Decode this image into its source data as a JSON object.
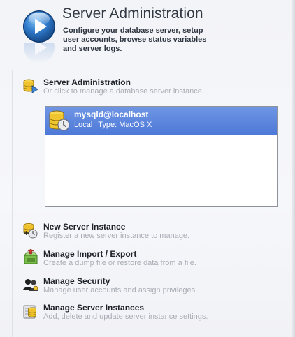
{
  "header": {
    "title": "Server Administration",
    "description": "Configure your database server, setup user accounts, browse status variables and server logs.",
    "icon": "play-circle-icon",
    "accent": "#2f79c9"
  },
  "server_admin": {
    "title": "Server Administration",
    "subtitle": "Or click to manage a database server instance.",
    "icon": "database-server-icon"
  },
  "instances": [
    {
      "name": "mysqld@localhost",
      "location": "Local",
      "type_label": "Type: MacOS X",
      "selected": true,
      "icon": "database-clock-icon"
    }
  ],
  "selection_color": "#5a84dc",
  "actions": [
    {
      "title": "New Server Instance",
      "subtitle": "Register a new server instance to manage.",
      "icon": "database-add-icon"
    },
    {
      "title": "Manage Import / Export",
      "subtitle": "Create a dump file or restore data from a file.",
      "icon": "import-export-icon"
    },
    {
      "title": "Manage Security",
      "subtitle": "Manage user accounts and assign privileges.",
      "icon": "users-security-icon"
    },
    {
      "title": "Manage Server Instances",
      "subtitle": "Add, delete and update server instance settings.",
      "icon": "database-list-icon"
    }
  ]
}
